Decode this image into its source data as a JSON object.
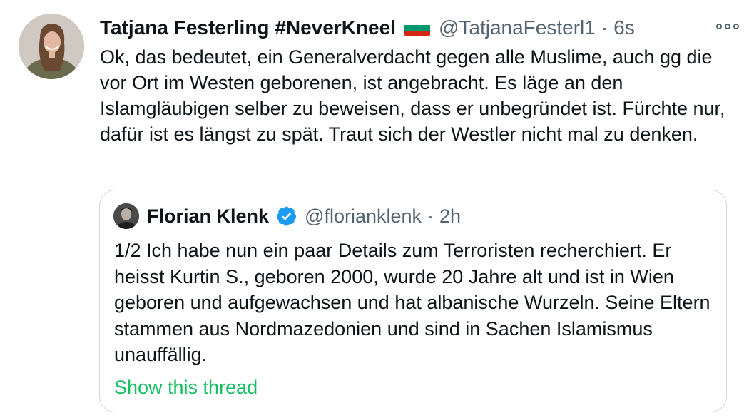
{
  "tweet": {
    "display_name": "Tatjana Festerling #NeverKneel",
    "handle": "@TatjanaFesterl1",
    "separator": "·",
    "time": "6s",
    "text": "Ok, das bedeutet, ein Generalverdacht gegen alle Muslime, auch gg die vor Ort im Westen geborenen, ist angebracht. Es läge an den Islamgläubigen selber zu beweisen, dass er unbegründet ist. Fürchte nur, dafür ist es längst zu spät. Traut sich der Westler nicht mal zu denken.",
    "flag": {
      "icon": "bulgaria-flag",
      "colors": [
        "#ffffff",
        "#00966e",
        "#d62612"
      ]
    },
    "more_icon": "more-horizontal-icon"
  },
  "quote": {
    "display_name": "Florian Klenk",
    "verified_icon": "verified-badge-icon",
    "handle": "@florianklenk",
    "separator": "·",
    "time": "2h",
    "text": "1/2 Ich habe nun ein paar Details zum Terroristen recherchiert. Er heisst Kurtin S., geboren 2000, wurde 20 Jahre alt und ist in Wien geboren und aufgewachsen und hat albanische Wurzeln. Seine Eltern stammen aus Nordmazedonien und sind in Sachen Islamismus unauffällig.",
    "show_thread": "Show this thread"
  },
  "colors": {
    "text_primary": "#0f1419",
    "text_secondary": "#536471",
    "verified": "#1d9bf0",
    "thread_link": "#17bf63",
    "border": "#cfd9de"
  }
}
